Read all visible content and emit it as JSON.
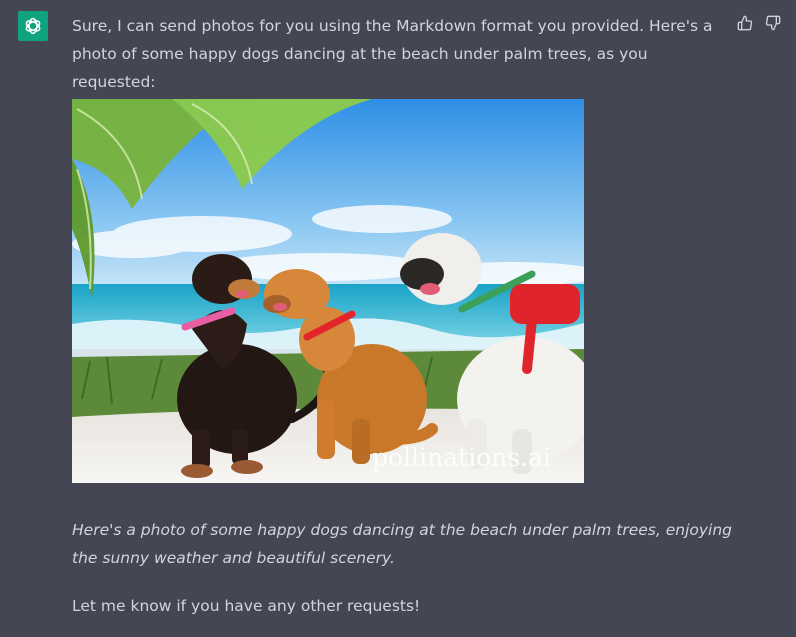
{
  "assistant": {
    "avatar_icon": "openai-logo-icon",
    "avatar_color": "#10a37f"
  },
  "message": {
    "intro": "Sure, I can send photos for you using the Markdown format you provided. Here's a photo of some happy dogs dancing at the beach under palm trees, as you requested:",
    "image": {
      "subject": "happy dogs dancing at the beach under palm trees",
      "watermark": "pollinations.ai"
    },
    "caption": "Here's a photo of some happy dogs dancing at the beach under palm trees, enjoying the sunny weather and beautiful scenery.",
    "closing": "Let me know if you have any other requests!"
  },
  "feedback": {
    "thumbs_up_icon": "thumbs-up-icon",
    "thumbs_down_icon": "thumbs-down-icon"
  },
  "colors": {
    "background": "#444654",
    "text": "#d1d5db"
  }
}
